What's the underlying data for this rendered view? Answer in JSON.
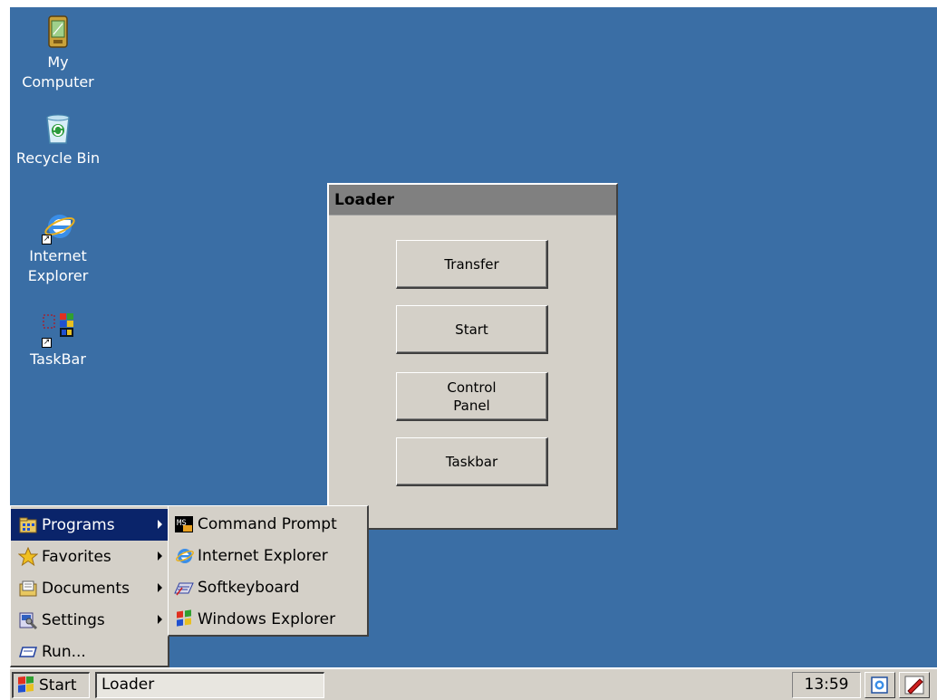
{
  "desktop": {
    "background_color": "#3a6ea5",
    "icons": [
      {
        "label": "My\nComputer",
        "icon": "pda-icon"
      },
      {
        "label": "Recycle Bin",
        "icon": "recycle-bin-icon"
      },
      {
        "label": "Internet\nExplorer",
        "icon": "internet-explorer-icon"
      },
      {
        "label": "TaskBar",
        "icon": "taskbar-icon"
      }
    ]
  },
  "loader_window": {
    "title": "Loader",
    "buttons": [
      {
        "label": "Transfer"
      },
      {
        "label": "Start"
      },
      {
        "label": "Control\nPanel"
      },
      {
        "label": "Taskbar"
      }
    ]
  },
  "start_menu": {
    "items": [
      {
        "label": "Programs",
        "icon": "programs-folder-icon",
        "has_submenu": true,
        "selected": true
      },
      {
        "label": "Favorites",
        "icon": "star-icon",
        "has_submenu": true
      },
      {
        "label": "Documents",
        "icon": "documents-folder-icon",
        "has_submenu": true
      },
      {
        "label": "Settings",
        "icon": "settings-icon",
        "has_submenu": true
      },
      {
        "label": "Run...",
        "icon": "run-icon",
        "has_submenu": false
      }
    ]
  },
  "programs_submenu": {
    "items": [
      {
        "label": "Command Prompt",
        "icon": "command-prompt-icon"
      },
      {
        "label": "Internet Explorer",
        "icon": "internet-explorer-icon"
      },
      {
        "label": "Softkeyboard",
        "icon": "keyboard-icon"
      },
      {
        "label": "Windows Explorer",
        "icon": "windows-explorer-icon"
      }
    ]
  },
  "taskbar": {
    "start_label": "Start",
    "tasks": [
      {
        "label": "Loader"
      }
    ],
    "clock": "13:59",
    "tray_icons": [
      "connection-icon",
      "pen-icon"
    ]
  }
}
